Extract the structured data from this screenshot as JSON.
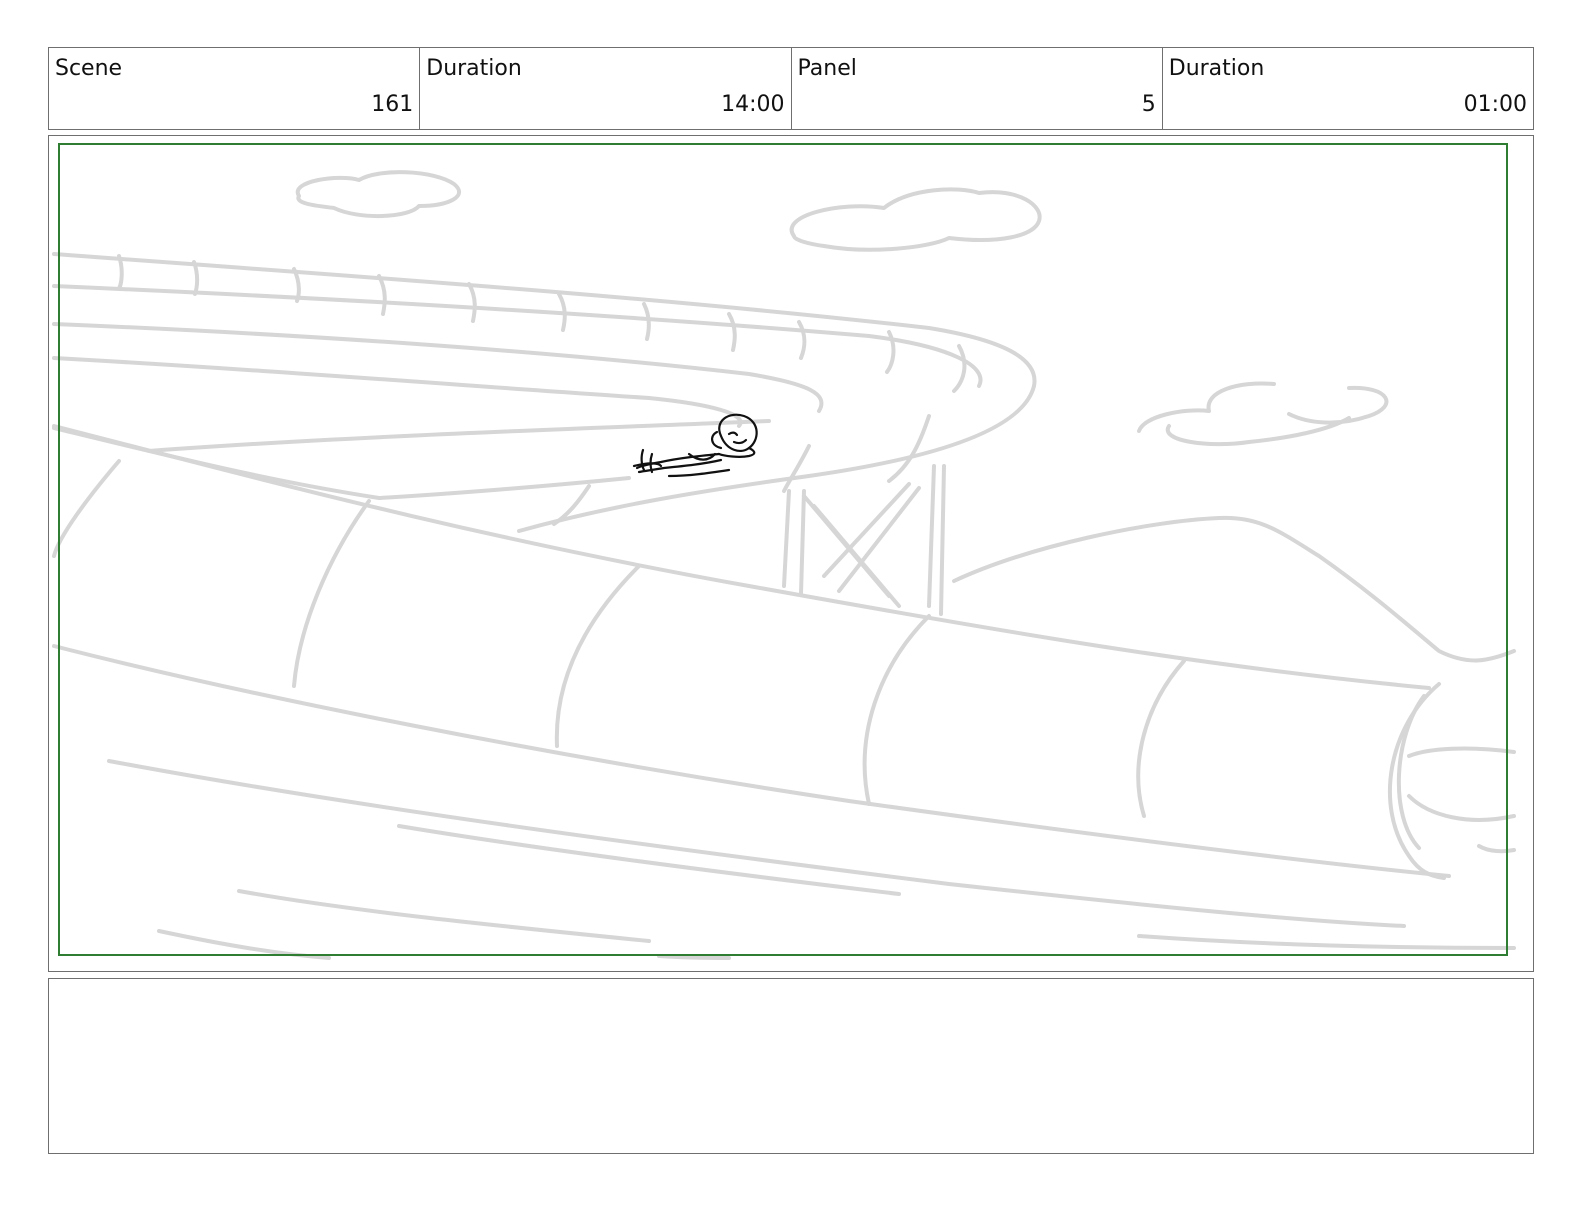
{
  "header": {
    "scene_label": "Scene",
    "scene_value": "161",
    "scene_duration_label": "Duration",
    "scene_duration_value": "14:00",
    "panel_label": "Panel",
    "panel_value": "5",
    "panel_duration_label": "Duration",
    "panel_duration_value": "01:00"
  },
  "frame": {
    "safe_area_color": "#2e7d32",
    "background_sketch_color": "#d6d6d6",
    "character_sketch_color": "#111111"
  },
  "notes": {
    "text": ""
  }
}
